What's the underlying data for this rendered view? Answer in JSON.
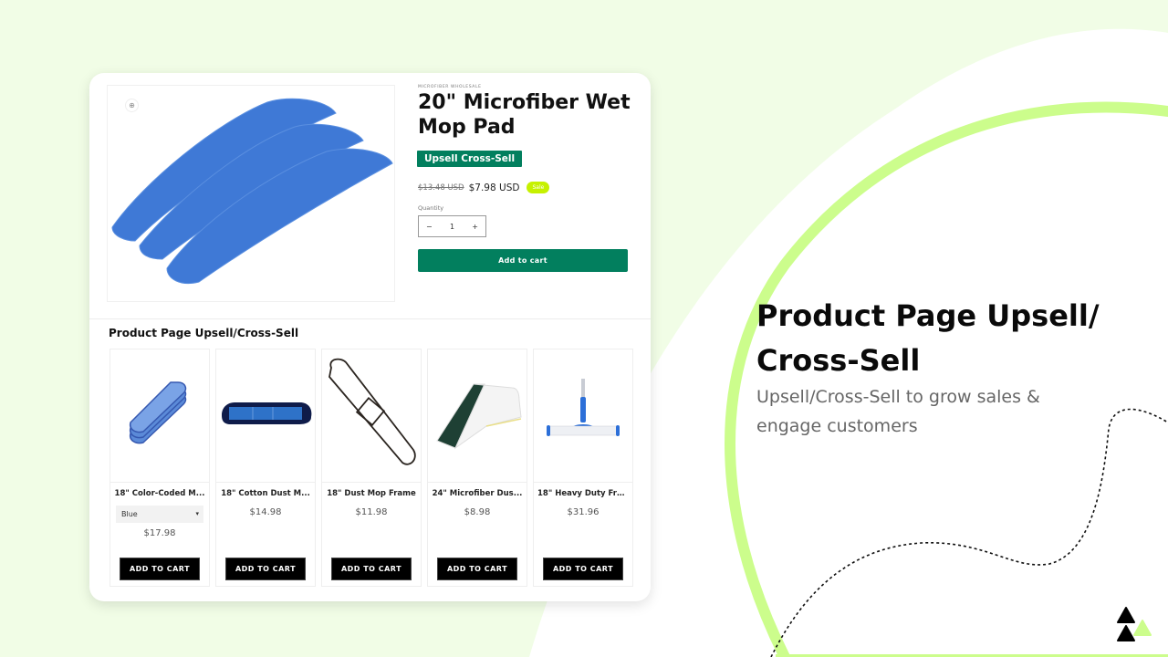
{
  "colors": {
    "page_bg": "#f1fde6",
    "accent_green": "#027f5e",
    "lime": "#ccfd8c",
    "sale_badge": "#c6f100",
    "black": "#000000"
  },
  "product": {
    "vendor": "MICROFIBER WHOLESALE",
    "title": "20\" Microfiber Wet Mop Pad",
    "badge": "Upsell Cross-Sell",
    "old_price": "$13.48 USD",
    "new_price": "$7.98 USD",
    "sale_label": "Sale",
    "quantity_label": "Quantity",
    "quantity_value": "1",
    "qty_minus": "−",
    "qty_plus": "+",
    "add_to_cart": "Add to cart",
    "zoom_icon": "zoom-in-icon"
  },
  "upsell": {
    "heading": "Product Page Upsell/Cross-Sell",
    "products": [
      {
        "name": "18\" Color-Coded M...",
        "price": "$17.98",
        "variant": "Blue",
        "button": "ADD TO CART",
        "image": "stacked-blue-pads"
      },
      {
        "name": "18\" Cotton Dust M...",
        "price": "$14.98",
        "button": "ADD TO CART",
        "image": "navy-dust-mop"
      },
      {
        "name": "18\" Dust Mop Frame",
        "price": "$11.98",
        "button": "ADD TO CART",
        "image": "wire-frame"
      },
      {
        "name": "24\" Microfiber Dus...",
        "price": "$8.98",
        "button": "ADD TO CART",
        "image": "green-microfiber-pad"
      },
      {
        "name": "18\" Heavy Duty Fra...",
        "price": "$31.96",
        "button": "ADD TO CART",
        "image": "mop-frame-handle"
      }
    ]
  },
  "promo": {
    "title": "Product Page Upsell/ Cross-Sell",
    "subtitle": "Upsell/Cross-Sell to grow sales & engage customers"
  }
}
